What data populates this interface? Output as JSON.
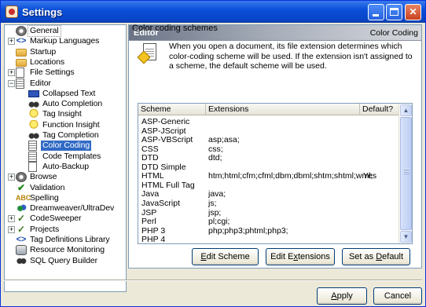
{
  "window": {
    "title": "Settings"
  },
  "tree": [
    {
      "label": "General",
      "icon": "gear-icon",
      "expander": "",
      "indent": 0,
      "selected": false,
      "dotted": true
    },
    {
      "label": "Markup Languages",
      "icon": "tags-icon",
      "expander": "+",
      "indent": 0
    },
    {
      "label": "Startup",
      "icon": "folder-icon",
      "expander": "",
      "indent": 0
    },
    {
      "label": "Locations",
      "icon": "folder-icon",
      "expander": "",
      "indent": 0
    },
    {
      "label": "File Settings",
      "icon": "page-icon",
      "expander": "+",
      "indent": 0
    },
    {
      "label": "Editor",
      "icon": "page-lines-icon",
      "expander": "−",
      "indent": 0
    },
    {
      "label": "Collapsed Text",
      "icon": "collapsed-text-icon",
      "expander": "",
      "indent": 1
    },
    {
      "label": "Auto Completion",
      "icon": "binoculars-icon",
      "expander": "",
      "indent": 1
    },
    {
      "label": "Tag Insight",
      "icon": "bulb-icon",
      "expander": "",
      "indent": 1
    },
    {
      "label": "Function Insight",
      "icon": "bulb-icon",
      "expander": "",
      "indent": 1
    },
    {
      "label": "Tag Completion",
      "icon": "binoculars-icon",
      "expander": "",
      "indent": 1
    },
    {
      "label": "Color Coding",
      "icon": "page-lines-icon",
      "expander": "",
      "indent": 1,
      "selected": true
    },
    {
      "label": "Code Templates",
      "icon": "page-lines-icon",
      "expander": "",
      "indent": 1
    },
    {
      "label": "Auto-Backup",
      "icon": "page-icon",
      "expander": "",
      "indent": 1
    },
    {
      "label": "Browse",
      "icon": "globe-icon",
      "expander": "+",
      "indent": 0
    },
    {
      "label": "Validation",
      "icon": "check-icon",
      "expander": "",
      "indent": 0
    },
    {
      "label": "Spelling",
      "icon": "spell-icon",
      "expander": "",
      "indent": 0
    },
    {
      "label": "Dreamweaver/UltraDev",
      "icon": "dreamweaver-icon",
      "expander": "",
      "indent": 0
    },
    {
      "label": "CodeSweeper",
      "icon": "sweep-icon",
      "expander": "+",
      "indent": 0
    },
    {
      "label": "Projects",
      "icon": "sweep-icon",
      "expander": "+",
      "indent": 0
    },
    {
      "label": "Tag Definitions Library",
      "icon": "tags-icon",
      "expander": "",
      "indent": 0
    },
    {
      "label": "Resource Monitoring",
      "icon": "monitor-icon",
      "expander": "",
      "indent": 0
    },
    {
      "label": "SQL Query Builder",
      "icon": "sql-icon",
      "expander": "",
      "indent": 0
    }
  ],
  "panel": {
    "header_left": "Editor",
    "header_right": "Color Coding",
    "section_title": "Color coding schemes",
    "info_text": "When you open a document, its file extension determines which color-coding scheme will be used.  If the extension isn't assigned to a scheme, the default scheme will be used."
  },
  "grid": {
    "columns": [
      "Scheme",
      "Extensions",
      "Default?"
    ],
    "rows": [
      {
        "scheme": "ASP-Generic",
        "ext": "",
        "default": ""
      },
      {
        "scheme": "ASP-JScript",
        "ext": "",
        "default": ""
      },
      {
        "scheme": "ASP-VBScript",
        "ext": "asp;asa;",
        "default": ""
      },
      {
        "scheme": "CSS",
        "ext": "css;",
        "default": ""
      },
      {
        "scheme": "DTD",
        "ext": "dtd;",
        "default": ""
      },
      {
        "scheme": "DTD Simple",
        "ext": "",
        "default": ""
      },
      {
        "scheme": "HTML",
        "ext": "htm;html;cfm;cfml;dbm;dbml;shtm;shtml;wml;",
        "default": "Yes"
      },
      {
        "scheme": "HTML Full Tag",
        "ext": "",
        "default": ""
      },
      {
        "scheme": "Java",
        "ext": "java;",
        "default": ""
      },
      {
        "scheme": "JavaScript",
        "ext": "js;",
        "default": ""
      },
      {
        "scheme": "JSP",
        "ext": "jsp;",
        "default": ""
      },
      {
        "scheme": "Perl",
        "ext": "pl;cgi;",
        "default": ""
      },
      {
        "scheme": "PHP 3",
        "ext": "php;php3;phtml;php3;",
        "default": ""
      },
      {
        "scheme": "PHP 4",
        "ext": "",
        "default": ""
      }
    ]
  },
  "buttons": {
    "edit_scheme": {
      "pre": "",
      "u": "E",
      "post": "dit Scheme"
    },
    "edit_extensions": {
      "pre": "Edit E",
      "u": "x",
      "post": "tensions"
    },
    "set_default": {
      "pre": "Set as ",
      "u": "D",
      "post": "efault"
    },
    "apply": {
      "pre": "",
      "u": "A",
      "post": "pply"
    },
    "cancel": "Cancel"
  }
}
